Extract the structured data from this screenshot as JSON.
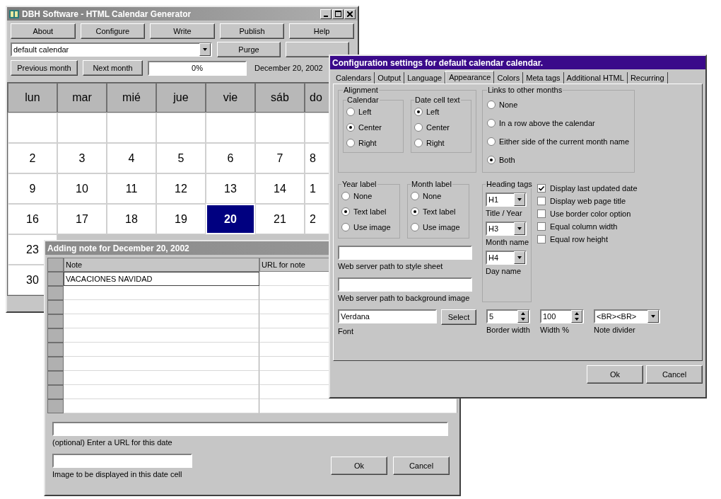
{
  "main_window": {
    "title": "DBH Software - HTML Calendar Generator",
    "toolbar": [
      "About",
      "Configure",
      "Write",
      "Publish",
      "Help"
    ],
    "calendar_select": {
      "value": "default calendar"
    },
    "purge_button": "Purge",
    "nav_buttons": [
      "Previous month",
      "Next month"
    ],
    "progress": {
      "level": 0,
      "reading": "0%"
    },
    "date_label": "December 20, 2002",
    "calendar": {
      "day_headers": [
        "lun",
        "mar",
        "mié",
        "jue",
        "vie",
        "sáb",
        "do"
      ],
      "weeks": [
        [
          {
            "label": "2",
            "selected": false
          },
          {
            "label": "3",
            "selected": false
          },
          {
            "label": "4",
            "selected": false
          },
          {
            "label": "5",
            "selected": false
          },
          {
            "label": "6",
            "selected": false
          },
          {
            "label": "7",
            "selected": false
          },
          {
            "label": "8",
            "selected": false
          }
        ],
        [
          {
            "label": "9",
            "selected": false
          },
          {
            "label": "10",
            "selected": false
          },
          {
            "label": "11",
            "selected": false
          },
          {
            "label": "12",
            "selected": false
          },
          {
            "label": "13",
            "selected": false
          },
          {
            "label": "14",
            "selected": false
          },
          {
            "label": "1",
            "selected": false
          }
        ],
        [
          {
            "label": "16",
            "selected": false
          },
          {
            "label": "17",
            "selected": false
          },
          {
            "label": "18",
            "selected": false
          },
          {
            "label": "19",
            "selected": false
          },
          {
            "label": "20",
            "selected": true
          },
          {
            "label": "21",
            "selected": false
          },
          {
            "label": "2",
            "selected": false
          }
        ],
        [
          {
            "label": "23",
            "selected": false
          }
        ],
        [
          {
            "label": "30",
            "selected": false
          }
        ]
      ]
    }
  },
  "notes_window": {
    "title": "Adding note for December 20, 2002",
    "columns": [
      "Note",
      "URL for note"
    ],
    "rows": [
      {
        "note": "VACACIONES NAVIDAD"
      }
    ],
    "url_field": {
      "caption": "(optional) Enter a URL for this date"
    },
    "image_field": {
      "caption": "Image to be displayed in this date cell"
    },
    "buttons": [
      "Ok",
      "Cancel"
    ]
  },
  "config_window": {
    "title": "Configuration settings for default calendar calendar.",
    "tabs": [
      {
        "label": "Calendars",
        "selected": false
      },
      {
        "label": "Output",
        "selected": false
      },
      {
        "label": "Language",
        "selected": false
      },
      {
        "label": "Appearance",
        "selected": true
      },
      {
        "label": "Colors",
        "selected": false
      },
      {
        "label": "Meta tags",
        "selected": false
      },
      {
        "label": "Additional HTML",
        "selected": false
      },
      {
        "label": "Recurring",
        "selected": false
      }
    ],
    "alignment": {
      "label": "Alignment",
      "groups": [
        {
          "label": "Calendar",
          "options": [
            {
              "label": "Left",
              "selected": false
            },
            {
              "label": "Center",
              "selected": true
            },
            {
              "label": "Right",
              "selected": false
            }
          ]
        },
        {
          "label": "Date cell text",
          "options": [
            {
              "label": "Left",
              "selected": true
            },
            {
              "label": "Center",
              "selected": false
            },
            {
              "label": "Right",
              "selected": false
            }
          ]
        }
      ]
    },
    "links": {
      "label": "Links to other months",
      "options": [
        {
          "label": "None",
          "selected": false
        },
        {
          "label": "In a row above the calendar",
          "selected": false
        },
        {
          "label": "Either side of the current month name",
          "selected": false
        },
        {
          "label": "Both",
          "selected": true
        }
      ]
    },
    "label_groups": [
      {
        "label": "Year label",
        "options": [
          {
            "label": "None",
            "selected": false
          },
          {
            "label": "Text label",
            "selected": true
          },
          {
            "label": "Use image",
            "selected": false
          }
        ]
      },
      {
        "label": "Month label",
        "options": [
          {
            "label": "None",
            "selected": false
          },
          {
            "label": "Text label",
            "selected": true
          },
          {
            "label": "Use image",
            "selected": false
          }
        ]
      }
    ],
    "path_fields": [
      {
        "caption": "Web server path to style sheet"
      },
      {
        "caption": "Web server path to background image"
      }
    ],
    "heading_tags": {
      "label": "Heading tags",
      "selects": [
        {
          "value": "H1",
          "caption": "Title / Year"
        },
        {
          "value": "H3",
          "caption": "Month name"
        },
        {
          "value": "H4",
          "caption": "Day name"
        }
      ]
    },
    "options": [
      {
        "label": "Display last updated date",
        "checked": true
      },
      {
        "label": "Display web page title",
        "checked": false
      },
      {
        "label": "Use border color option",
        "checked": false
      },
      {
        "label": "Equal column width",
        "checked": false
      },
      {
        "label": "Equal row height",
        "checked": false
      }
    ],
    "font": {
      "value": "Verdana",
      "caption": "Font",
      "button": "Select"
    },
    "spinners": [
      {
        "value": "5",
        "caption": "Border width"
      },
      {
        "value": "100",
        "caption": "Width %"
      }
    ],
    "note_divider": {
      "value": "<BR><BR>",
      "caption": "Note divider"
    },
    "buttons": [
      "Ok",
      "Cancel"
    ]
  }
}
